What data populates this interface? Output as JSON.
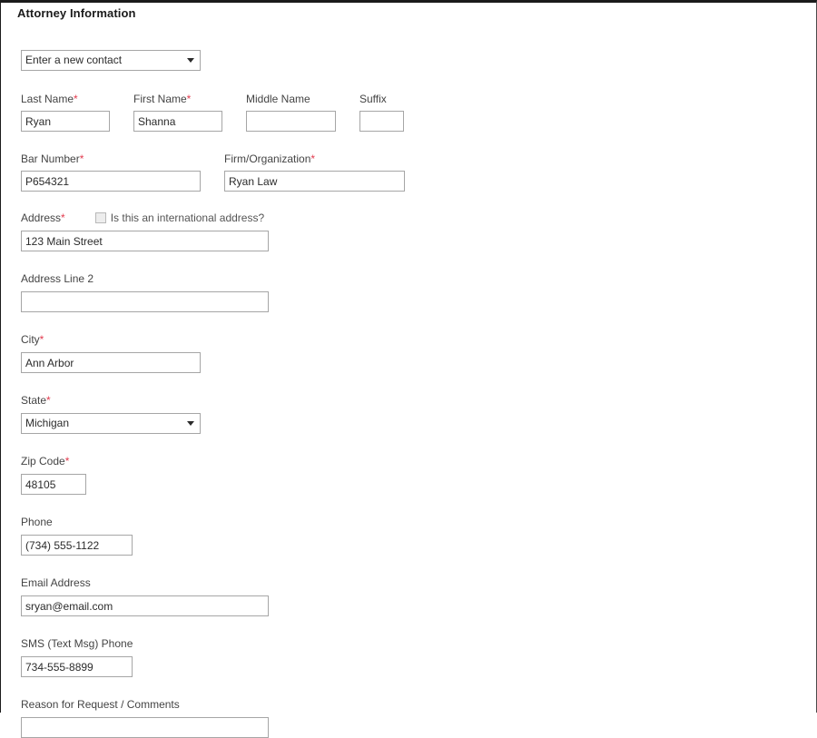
{
  "section": {
    "title": "Attorney Information"
  },
  "contact_picker": {
    "label": "",
    "value": "Enter a new contact",
    "options": [
      "Enter a new contact"
    ]
  },
  "required_marker": "*",
  "fields": {
    "last_name": {
      "label": "Last Name",
      "required": true,
      "value": "Ryan",
      "placeholder": ""
    },
    "first_name": {
      "label": "First Name",
      "required": true,
      "value": "Shanna",
      "placeholder": ""
    },
    "middle_name": {
      "label": "Middle Name",
      "required": false,
      "value": "",
      "placeholder": ""
    },
    "suffix": {
      "label": "Suffix",
      "required": false,
      "value": "",
      "placeholder": ""
    },
    "bar_number": {
      "label": "Bar Number",
      "required": true,
      "value": "P654321",
      "placeholder": ""
    },
    "firm": {
      "label": "Firm/Organization",
      "required": true,
      "value": "Ryan Law",
      "placeholder": ""
    },
    "address": {
      "label": "Address",
      "required": true,
      "value": "123 Main Street",
      "placeholder": ""
    },
    "address2": {
      "label": "Address Line 2",
      "required": false,
      "value": "",
      "placeholder": ""
    },
    "city": {
      "label": "City",
      "required": true,
      "value": "Ann Arbor",
      "placeholder": ""
    },
    "state": {
      "label": "State",
      "required": true,
      "value": "Michigan",
      "options": [
        "Michigan"
      ]
    },
    "zip": {
      "label": "Zip Code",
      "required": true,
      "value": "48105",
      "placeholder": ""
    },
    "phone": {
      "label": "Phone",
      "required": false,
      "value": "(734) 555-1122",
      "placeholder": ""
    },
    "email": {
      "label": "Email Address",
      "required": false,
      "value": "sryan@email.com",
      "placeholder": ""
    },
    "sms": {
      "label": "SMS (Text Msg) Phone",
      "required": false,
      "value": "734-555-8899",
      "placeholder": ""
    },
    "reason": {
      "label": "Reason for Request / Comments",
      "required": false,
      "value": "",
      "placeholder": ""
    }
  },
  "international_checkbox": {
    "label": "Is this an international address?",
    "checked": false
  },
  "colors": {
    "required_asterisk": "#e23b4e",
    "label_text": "#444444",
    "input_border": "#a6a6a6",
    "input_text": "#2b2b2b",
    "title_text": "#1b1b1b",
    "panel_border": "#1b1b1b",
    "background": "#ffffff"
  }
}
